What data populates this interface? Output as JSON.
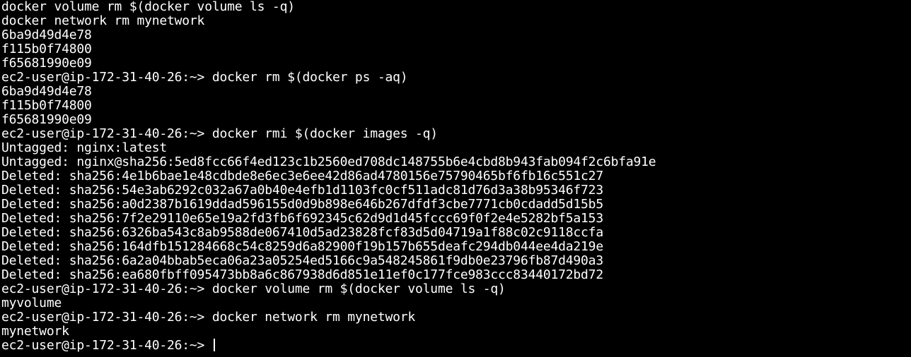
{
  "terminal": {
    "lines": [
      "docker volume rm $(docker volume ls -q)",
      "docker network rm mynetwork",
      "6ba9d49d4e78",
      "f115b0f74800",
      "f65681990e09",
      "ec2-user@ip-172-31-40-26:~> docker rm $(docker ps -aq)",
      "6ba9d49d4e78",
      "f115b0f74800",
      "f65681990e09",
      "ec2-user@ip-172-31-40-26:~> docker rmi $(docker images -q)",
      "Untagged: nginx:latest",
      "Untagged: nginx@sha256:5ed8fcc66f4ed123c1b2560ed708dc148755b6e4cbd8b943fab094f2c6bfa91e",
      "Deleted: sha256:4e1b6bae1e48cdbde8e6ec3e6ee42d86ad4780156e75790465bf6fb16c551c27",
      "Deleted: sha256:54e3ab6292c032a67a0b40e4efb1d1103fc0cf511adc81d76d3a38b95346f723",
      "Deleted: sha256:a0d2387b1619ddad596155d0d9b898e646b267dfdf3cbe7771cb0cdadd5d15b5",
      "Deleted: sha256:7f2e29110e65e19a2fd3fb6f692345c62d9d1d45fccc69f0f2e4e5282bf5a153",
      "Deleted: sha256:6326ba543c8ab9588de067410d5ad23828fcf83d5d04719a1f88c02c9118ccfa",
      "Deleted: sha256:164dfb151284668c54c8259d6a82900f19b157b655deafc294db044ee4da219e",
      "Deleted: sha256:6a2a04bbab5eca06a23a05254ed5166c9a548245861f9db0e23796fb87d490a3",
      "Deleted: sha256:ea680fbff095473bb8a6c867938d6d851e11ef0c177fce983ccc83440172bd72",
      "ec2-user@ip-172-31-40-26:~> docker volume rm $(docker volume ls -q)",
      "myvolume",
      "ec2-user@ip-172-31-40-26:~> docker network rm mynetwork",
      "mynetwork"
    ],
    "prompt": "ec2-user@ip-172-31-40-26:~> "
  },
  "colors": {
    "background": "#000000",
    "foreground": "#ffffff"
  }
}
